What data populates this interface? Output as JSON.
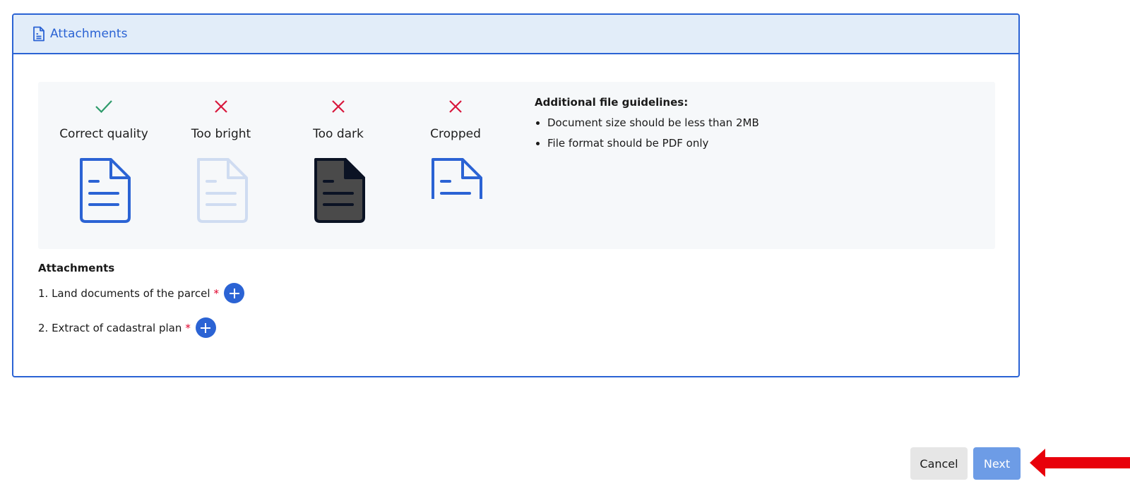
{
  "panel": {
    "title": "Attachments",
    "icon": "file-text-icon"
  },
  "quality_samples": [
    {
      "label": "Correct quality",
      "status": "check-icon",
      "status_color": "#2e9b6b",
      "doc_style": "normal"
    },
    {
      "label": "Too bright",
      "status": "cross-icon",
      "status_color": "#d8173c",
      "doc_style": "faded"
    },
    {
      "label": "Too dark",
      "status": "cross-icon",
      "status_color": "#d8173c",
      "doc_style": "dark"
    },
    {
      "label": "Cropped",
      "status": "cross-icon",
      "status_color": "#d8173c",
      "doc_style": "cropped"
    }
  ],
  "guidelines": {
    "title": "Additional file guidelines:",
    "items": [
      "Document size should be less than 2MB",
      "File format should be PDF only"
    ]
  },
  "attachments": {
    "title": "Attachments",
    "items": [
      {
        "label": "1. Land documents of the parcel",
        "required_marker": "*"
      },
      {
        "label": "2. Extract of cadastral plan",
        "required_marker": "*"
      }
    ]
  },
  "actions": {
    "cancel_label": "Cancel",
    "next_label": "Next"
  },
  "colors": {
    "accent": "#2b63d4",
    "header_bg": "#e2edf9",
    "next_bg": "#6d9ce6",
    "arrow": "#e8000b"
  }
}
